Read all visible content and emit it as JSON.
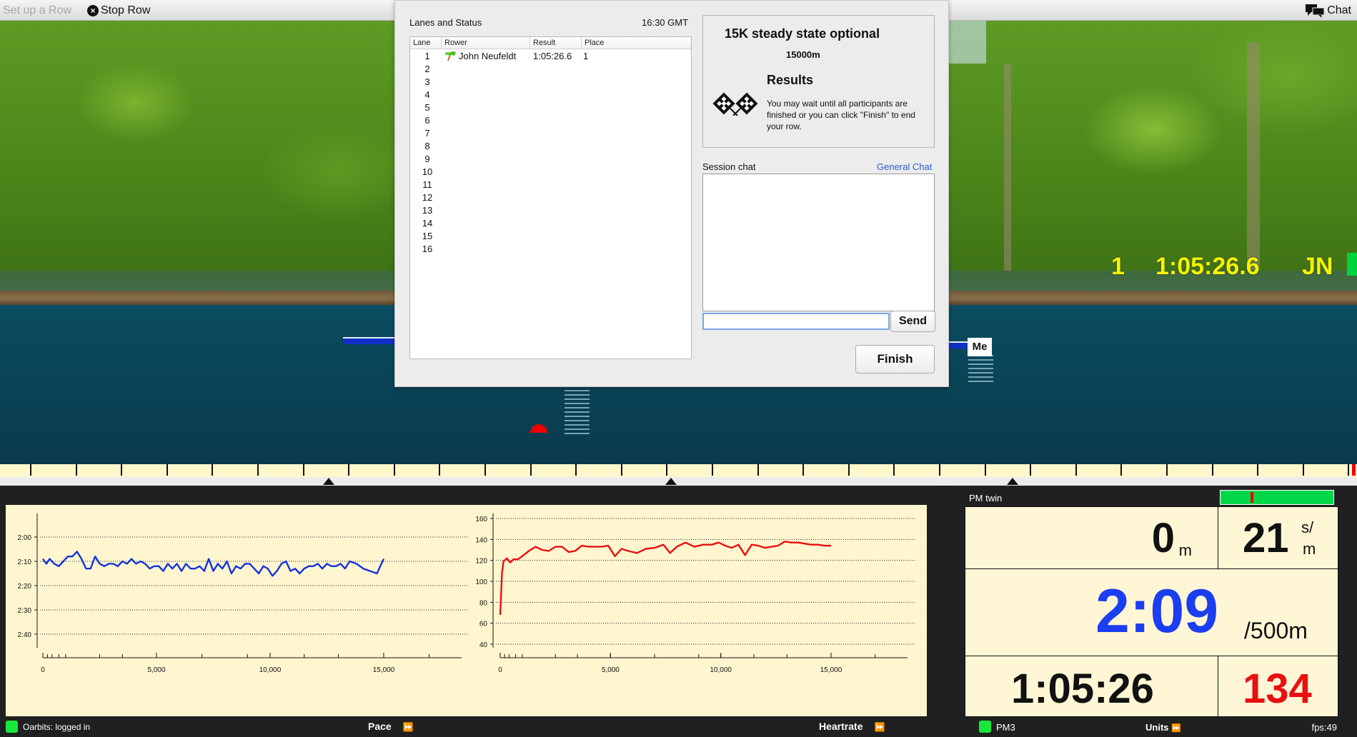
{
  "topbar": {
    "setup_label": "Set up a Row",
    "stop_label": "Stop Row",
    "chat_label": "Chat"
  },
  "scene": {
    "me_label": "Me",
    "standings": {
      "place": "1",
      "time": "1:05:26.6",
      "initials": "JN"
    }
  },
  "modal": {
    "lanes_title": "Lanes and Status",
    "clock": "16:30 GMT",
    "columns": [
      "Lane",
      "Rower",
      "Result",
      "Place"
    ],
    "rows": [
      {
        "lane": "1",
        "rower": "John Neufeldt",
        "result": "1:05:26.6",
        "place": "1",
        "flag": true
      },
      {
        "lane": "2",
        "rower": "",
        "result": "",
        "place": ""
      },
      {
        "lane": "3",
        "rower": "",
        "result": "",
        "place": ""
      },
      {
        "lane": "4",
        "rower": "",
        "result": "",
        "place": ""
      },
      {
        "lane": "5",
        "rower": "",
        "result": "",
        "place": ""
      },
      {
        "lane": "6",
        "rower": "",
        "result": "",
        "place": ""
      },
      {
        "lane": "7",
        "rower": "",
        "result": "",
        "place": ""
      },
      {
        "lane": "8",
        "rower": "",
        "result": "",
        "place": ""
      },
      {
        "lane": "9",
        "rower": "",
        "result": "",
        "place": ""
      },
      {
        "lane": "10",
        "rower": "",
        "result": "",
        "place": ""
      },
      {
        "lane": "11",
        "rower": "",
        "result": "",
        "place": ""
      },
      {
        "lane": "12",
        "rower": "",
        "result": "",
        "place": ""
      },
      {
        "lane": "13",
        "rower": "",
        "result": "",
        "place": ""
      },
      {
        "lane": "14",
        "rower": "",
        "result": "",
        "place": ""
      },
      {
        "lane": "15",
        "rower": "",
        "result": "",
        "place": ""
      },
      {
        "lane": "16",
        "rower": "",
        "result": "",
        "place": ""
      }
    ],
    "session_name": "15K steady state optional",
    "distance": "15000m",
    "results_title": "Results",
    "results_text": "You may wait until all participants are finished or you can click \"Finish\" to end your row.",
    "chat_label": "Session chat",
    "general_chat_link": "General Chat",
    "chat_input_value": "",
    "send_label": "Send",
    "finish_label": "Finish"
  },
  "status": {
    "oarbits": "Oarbits: logged in",
    "pace_label": "Pace",
    "heartrate_label": "Heartrate"
  },
  "pm": {
    "title": "PM twin",
    "distance_value": "0",
    "distance_unit": "m",
    "stroke_rate": "21",
    "stroke_rate_unit_top": "s/",
    "stroke_rate_unit_bottom": "m",
    "pace": "2:09",
    "pace_unit": "/500m",
    "elapsed": "1:05:26",
    "heartrate": "134",
    "meter_level": 0.27,
    "footer_pm": "PM3",
    "footer_units": "Units",
    "footer_fps": "fps:49",
    "colors": {
      "pace": "#1a3ef0",
      "heartrate": "#e81010"
    }
  },
  "chart_data": [
    {
      "type": "line",
      "title": "Pace",
      "xlabel": "",
      "ylabel": "",
      "x_ticks": [
        "0",
        "5,000",
        "10,000",
        "15,000"
      ],
      "x_tick_values": [
        0,
        5000,
        10000,
        15000
      ],
      "xlim": [
        0,
        17500
      ],
      "y_ticks": [
        "2:00",
        "2:10",
        "2:20",
        "2:30",
        "2:40"
      ],
      "y_tick_values": [
        120,
        130,
        140,
        150,
        160
      ],
      "ylim": [
        110,
        170
      ],
      "y_inverted": true,
      "grid": true,
      "color": "#1432e0",
      "series": [
        {
          "name": "Pace (sec/500m)",
          "x": [
            0,
            150,
            300,
            500,
            700,
            900,
            1100,
            1300,
            1500,
            1700,
            1900,
            2100,
            2300,
            2500,
            2700,
            2900,
            3100,
            3300,
            3500,
            3700,
            3900,
            4100,
            4300,
            4500,
            4700,
            4900,
            5100,
            5300,
            5500,
            5700,
            5900,
            6100,
            6300,
            6500,
            6700,
            6900,
            7100,
            7300,
            7500,
            7700,
            7900,
            8100,
            8300,
            8500,
            8700,
            8900,
            9100,
            9300,
            9500,
            9700,
            9900,
            10100,
            10300,
            10500,
            10700,
            10900,
            11100,
            11300,
            11500,
            11700,
            11900,
            12100,
            12300,
            12500,
            12700,
            12900,
            13100,
            13300,
            13500,
            13800,
            14100,
            14400,
            14700,
            14850,
            15000
          ],
          "values": [
            129,
            131,
            129,
            131,
            132,
            130,
            128,
            128,
            126,
            129,
            133,
            133,
            128,
            131,
            132,
            131,
            131,
            132,
            130,
            131,
            129,
            131,
            130,
            131,
            133,
            132,
            132,
            134,
            131,
            133,
            131,
            134,
            131,
            133,
            133,
            132,
            134,
            129,
            134,
            131,
            133,
            130,
            135,
            132,
            133,
            131,
            131,
            133,
            135,
            132,
            133,
            136,
            134,
            131,
            130,
            134,
            133,
            135,
            133,
            132,
            132,
            131,
            133,
            131,
            132,
            132,
            131,
            133,
            130,
            131,
            133,
            134,
            135,
            132,
            129
          ]
        }
      ]
    },
    {
      "type": "line",
      "title": "Heartrate",
      "xlabel": "",
      "ylabel": "",
      "x_ticks": [
        "0",
        "5,000",
        "10,000",
        "15,000"
      ],
      "x_tick_values": [
        0,
        5000,
        10000,
        15000
      ],
      "xlim": [
        0,
        17500
      ],
      "y_ticks": [
        "160",
        "140",
        "120",
        "100",
        "80",
        "60",
        "40"
      ],
      "y_tick_values": [
        160,
        140,
        120,
        100,
        80,
        60,
        40
      ],
      "ylim": [
        30,
        165
      ],
      "grid": true,
      "color": "#e81010",
      "series": [
        {
          "name": "Heartrate (bpm)",
          "x": [
            0,
            80,
            150,
            300,
            450,
            600,
            800,
            1000,
            1300,
            1600,
            1900,
            2200,
            2500,
            2800,
            3100,
            3400,
            3700,
            4000,
            4300,
            4600,
            4900,
            5200,
            5500,
            5800,
            6200,
            6600,
            7000,
            7400,
            7700,
            8000,
            8400,
            8800,
            9200,
            9600,
            9900,
            10200,
            10500,
            10800,
            11100,
            11400,
            11700,
            12000,
            12300,
            12600,
            12900,
            13200,
            13500,
            13800,
            14100,
            14400,
            14700,
            15000
          ],
          "values": [
            68,
            108,
            119,
            122,
            118,
            121,
            121,
            124,
            129,
            133,
            130,
            129,
            133,
            133,
            128,
            129,
            134,
            133,
            133,
            133,
            134,
            124,
            131,
            129,
            127,
            131,
            132,
            135,
            127,
            133,
            137,
            133,
            135,
            135,
            137,
            134,
            132,
            135,
            125,
            135,
            134,
            132,
            133,
            134,
            138,
            137,
            137,
            136,
            135,
            135,
            134,
            134
          ]
        }
      ]
    }
  ]
}
